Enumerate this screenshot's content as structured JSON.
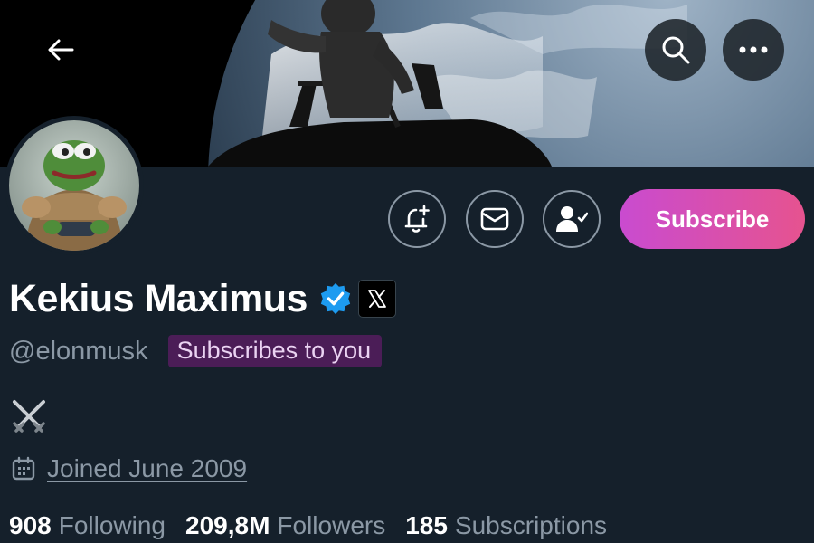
{
  "header": {
    "back_icon": "arrow-left-icon",
    "search_icon": "search-icon",
    "more_icon": "more-horizontal-icon"
  },
  "banner": {
    "description": "astronaut-on-spacecraft-over-earth"
  },
  "actions": {
    "notify_icon": "bell-plus-icon",
    "message_icon": "mail-icon",
    "following_icon": "person-check-icon",
    "subscribe_label": "Subscribe"
  },
  "profile": {
    "display_name": "Kekius Maximus",
    "verified_icon": "verified-badge-icon",
    "affiliation_icon": "x-logo-icon",
    "handle": "@elonmusk",
    "subscribes_badge": "Subscribes to you",
    "bio_icon": "crossed-swords-icon",
    "calendar_icon": "calendar-icon",
    "joined": "Joined June 2009"
  },
  "stats": {
    "following_count": "908",
    "following_label": "Following",
    "followers_count": "209,8M",
    "followers_label": "Followers",
    "subscriptions_count": "185",
    "subscriptions_label": "Subscriptions"
  },
  "colors": {
    "background": "#15202b",
    "subscribe_gradient_start": "#c94bd0",
    "subscribe_gradient_end": "#e6538f",
    "verified_blue": "#1d9bf0",
    "badge_bg": "#4b1d57",
    "muted_text": "#8b98a5"
  }
}
